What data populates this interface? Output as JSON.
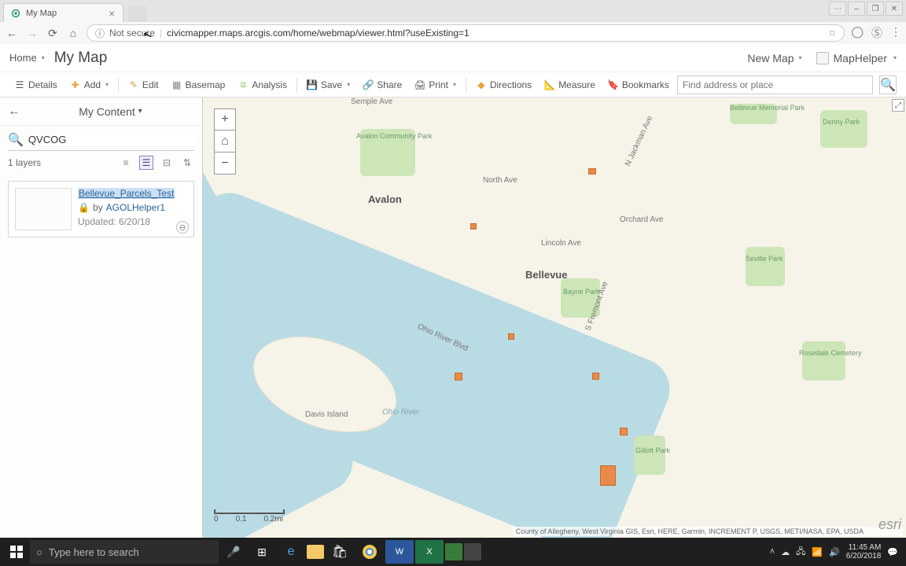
{
  "browser": {
    "tab_title": "My Map",
    "security": "Not secure",
    "url": "civicmapper.maps.arcgis.com/home/webmap/viewer.html?useExisting=1"
  },
  "header": {
    "home": "Home",
    "map_title": "My Map",
    "new_map": "New Map",
    "username": "MapHelper"
  },
  "toolbar": {
    "details": "Details",
    "add": "Add",
    "edit": "Edit",
    "basemap": "Basemap",
    "analysis": "Analysis",
    "save": "Save",
    "share": "Share",
    "print": "Print",
    "directions": "Directions",
    "measure": "Measure",
    "bookmarks": "Bookmarks",
    "search_placeholder": "Find address or place"
  },
  "side": {
    "title": "My Content",
    "search_value": "QVCOG",
    "count": "1 layers",
    "result": {
      "title": "Bellevue_Parcels_Test",
      "by_prefix": "by",
      "author": "AGOLHelper1",
      "updated": "Updated: 6/20/18"
    }
  },
  "map": {
    "scale": {
      "a": "0",
      "b": "0.1",
      "c": "0.2mi"
    },
    "attribution": "County of Allegheny, West Virginia GIS, Esri, HERE, Garmin, INCREMENT P, USGS, METI/NASA, EPA, USDA",
    "labels": {
      "bellevue": "Bellevue",
      "avalon": "Avalon",
      "ohio_river": "Ohio River",
      "davis_island": "Davis Island",
      "bayne_park": "Bayne Park",
      "avalon_park": "Avalon Community Park",
      "denny_park": "Denny Park",
      "seville_park": "Seville Park",
      "gillott_park": "Gillott Park",
      "rosedale_cem": "Rosedale Cemetery",
      "bellevue_mem": "Bellevue Memorial Park",
      "semple": "Semple Ave",
      "orchard": "Orchard Ave",
      "north": "North Ave",
      "lincoln": "Lincoln Ave",
      "fremont": "S Fremont Ave",
      "jackman": "N Jackman Ave",
      "ohio_river_blvd": "Ohio River Blvd"
    }
  },
  "taskbar": {
    "search_placeholder": "Type here to search",
    "time": "11:45 AM",
    "date": "6/20/2018"
  }
}
